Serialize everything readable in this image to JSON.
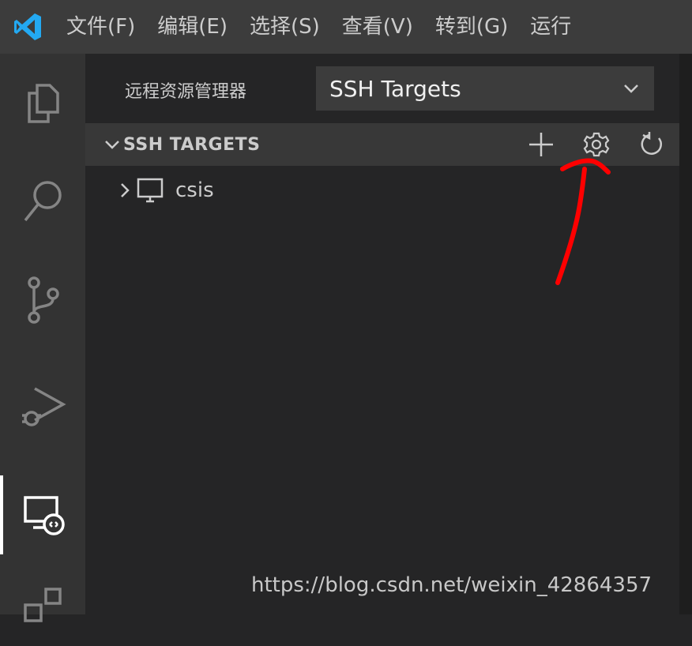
{
  "menu": {
    "items": [
      "文件(F)",
      "编辑(E)",
      "选择(S)",
      "查看(V)",
      "转到(G)",
      "运行"
    ]
  },
  "activity_bar": {
    "icons": [
      "explorer-icon",
      "search-icon",
      "source-control-icon",
      "run-debug-icon",
      "remote-explorer-icon",
      "extensions-icon"
    ]
  },
  "explorer": {
    "title": "远程资源管理器",
    "target_select": "SSH Targets"
  },
  "section": {
    "title": "SSH TARGETS",
    "actions": [
      "add-icon",
      "gear-icon",
      "refresh-icon"
    ]
  },
  "tree": {
    "items": [
      {
        "label": "csis",
        "icon": "monitor-icon"
      }
    ]
  },
  "watermark": "https://blog.csdn.net/weixin_42864357",
  "colors": {
    "titlebar": "#3c3c3c",
    "activitybar": "#333333",
    "sidebar": "#252526",
    "section_header": "#383838",
    "vscode_blue": "#23a9f2",
    "annotation_red": "#ff0000"
  }
}
